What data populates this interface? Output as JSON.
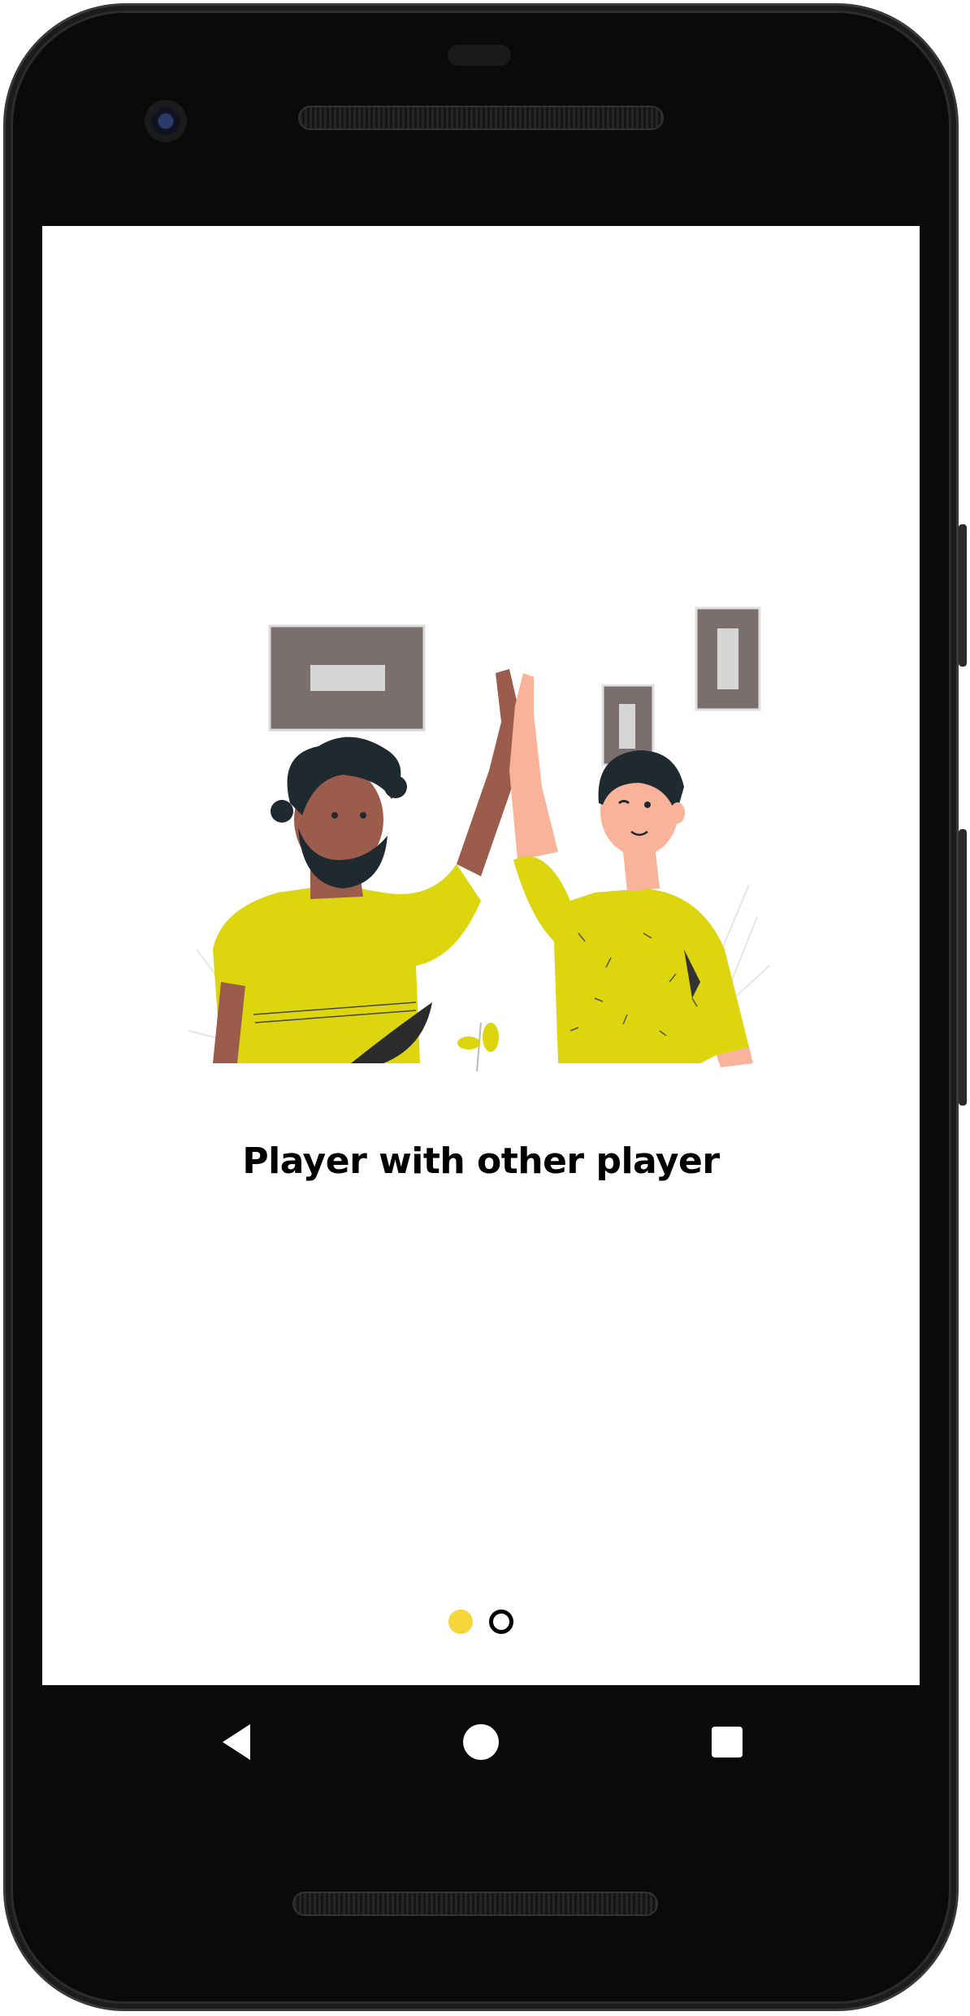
{
  "onboarding": {
    "caption": "Player with other player",
    "page_indicator": {
      "total": 2,
      "current": 1,
      "active_color": "#F7D63B",
      "inactive_color": "#000000"
    }
  },
  "illustration": {
    "name": "two-players-high-five-illustration",
    "shirt_color": "#DDD60F",
    "frame_color": "#7A6E6E"
  },
  "system_nav": {
    "back_icon": "triangle-back-icon",
    "home_icon": "circle-home-icon",
    "recents_icon": "square-recents-icon"
  }
}
